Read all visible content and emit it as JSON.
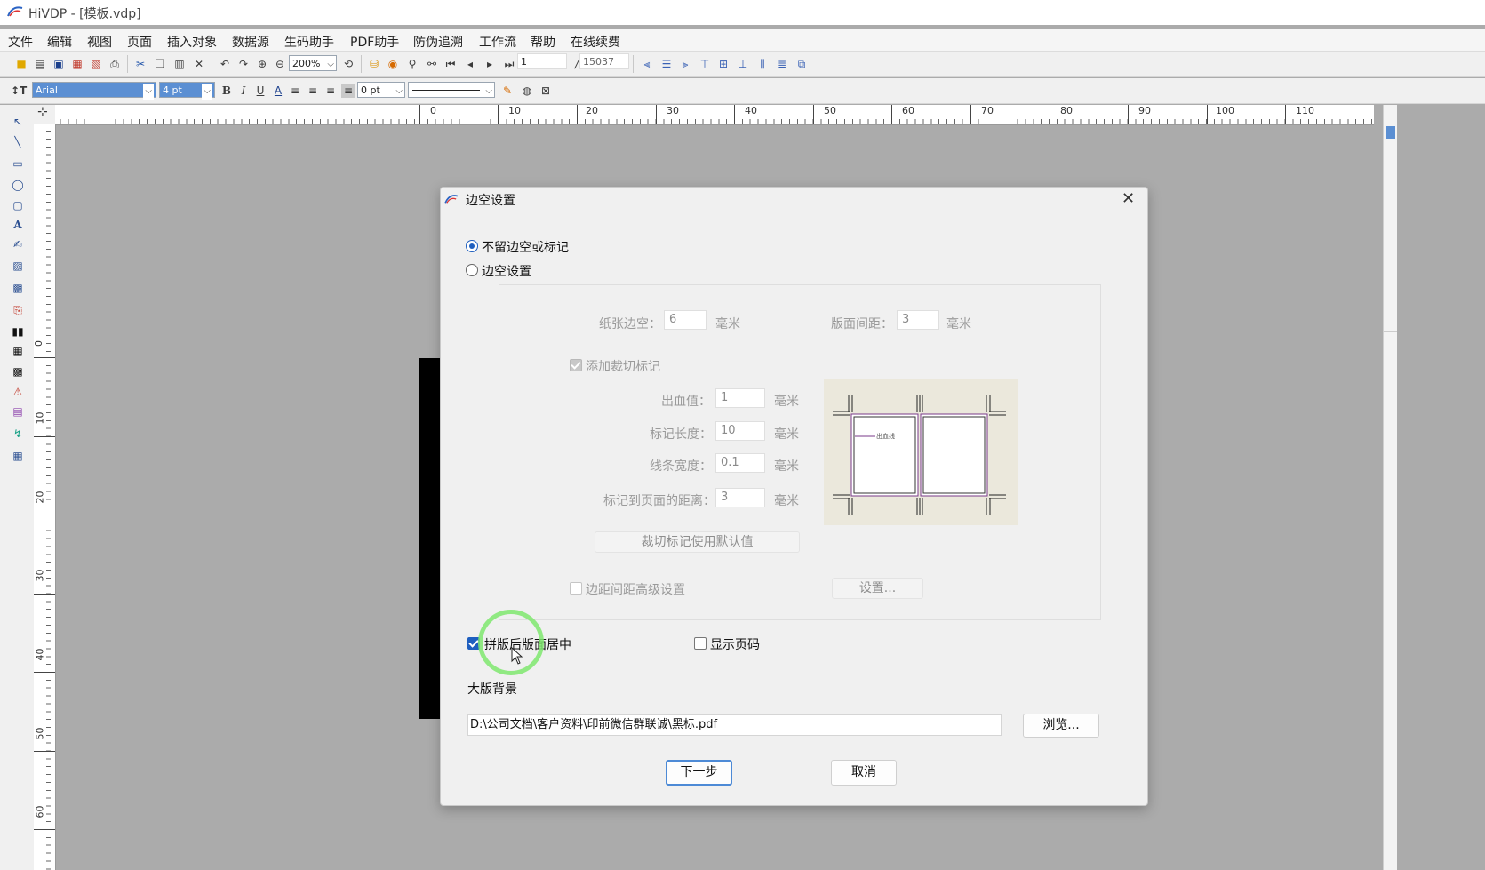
{
  "app": {
    "title": "HiVDP - [模板.vdp]"
  },
  "menu": [
    "文件",
    "编辑",
    "视图",
    "页面",
    "插入对象",
    "数据源",
    "生码助手",
    "PDF助手",
    "防伪追溯",
    "工作流",
    "帮助",
    "在线续费"
  ],
  "toolbar1": {
    "zoom": "200%",
    "page_current": "1",
    "page_total": "15037"
  },
  "toolbar2": {
    "font": "Arial",
    "font_size": "4 pt",
    "line_width": "0 pt"
  },
  "ruler": {
    "h_labels": [
      "0",
      "10",
      "20",
      "30",
      "40",
      "50",
      "60",
      "70",
      "80",
      "90",
      "100",
      "110"
    ],
    "v_labels": [
      "0",
      "10",
      "20",
      "30",
      "40",
      "50",
      "60"
    ]
  },
  "dialog": {
    "title": "边空设置",
    "radio_no_margin": "不留边空或标记",
    "radio_margin": "边空设置",
    "paper_margin_label": "纸张边空：",
    "paper_margin_value": "6",
    "unit_mm": "毫米",
    "page_gap_label": "版面间距：",
    "page_gap_value": "3",
    "add_crop_marks": "添加裁切标记",
    "bleed_label": "出血值：",
    "bleed_value": "1",
    "mark_length_label": "标记长度：",
    "mark_length_value": "10",
    "line_width_label": "线条宽度：",
    "line_width_value": "0.1",
    "mark_distance_label": "标记到页面的距离：",
    "mark_distance_value": "3",
    "preview_caption": "出血线",
    "default_marks_button": "裁切标记使用默认值",
    "advanced_margin": "边距间距高级设置",
    "settings_button": "设置...",
    "center_after_imposition": "拼版后版面居中",
    "show_page_number": "显示页码",
    "background_label": "大版背景",
    "background_path": "D:\\公司文档\\客户资料\\印前微信群联诚\\黑标.pdf",
    "browse_button": "浏览...",
    "next_button": "下一步",
    "cancel_button": "取消"
  },
  "colors": {
    "accent": "#1f5fbf",
    "highlight": "#7fe86f"
  }
}
